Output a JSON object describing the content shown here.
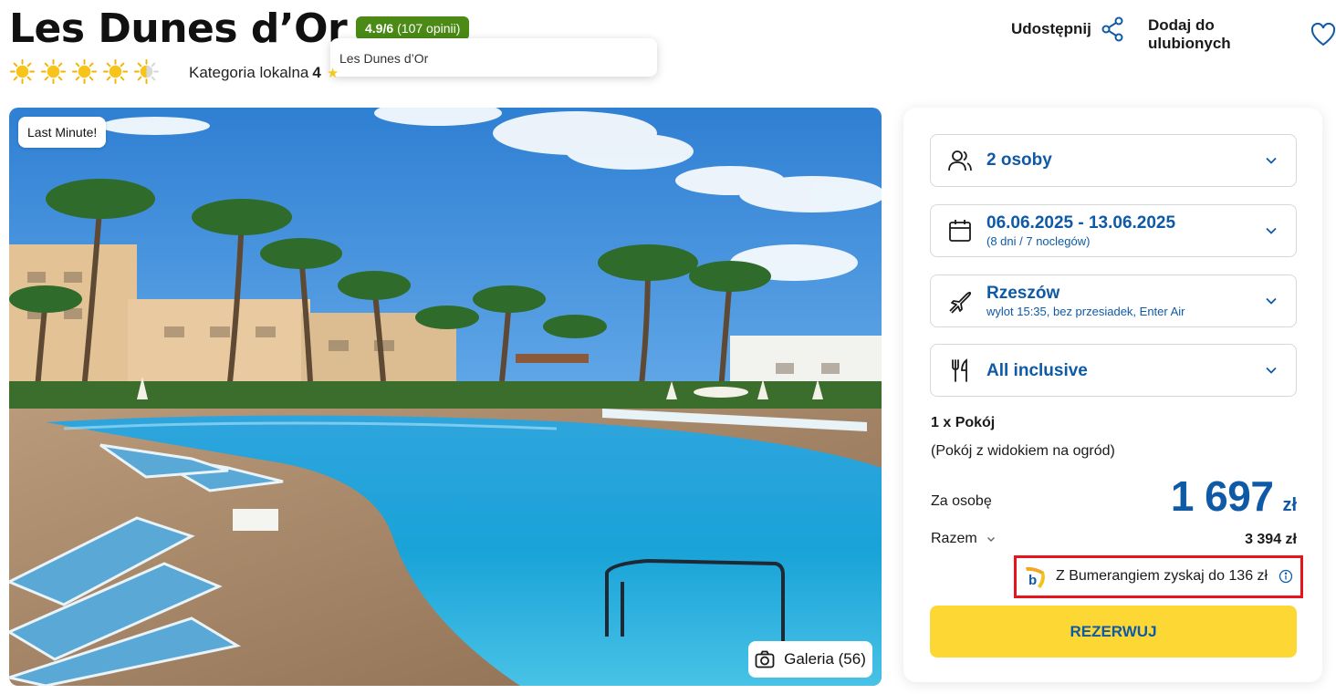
{
  "hotel": {
    "name": "Les Dunes d’Or",
    "rating": "4.9/6",
    "reviews": "(107 opinii)",
    "tooltip": "Les Dunes d’Or",
    "category_label": "Kategoria lokalna",
    "category_value": "4",
    "sun_rating": 4.5
  },
  "actions": {
    "share_label": "Udostępnij",
    "favorite_label": "Dodaj do ulubionych"
  },
  "photo": {
    "badge": "Last Minute!",
    "gallery_label": "Galeria (56)"
  },
  "booking": {
    "persons": "2 osoby",
    "dates": "06.06.2025 - 13.06.2025",
    "dates_sub": "(8 dni / 7 noclegów)",
    "departure": "Rzeszów",
    "departure_sub": "wylot 15:35, bez przesiadek, Enter Air",
    "board": "All inclusive",
    "room_title": "1 x Pokój",
    "room_sub": "(Pokój z widokiem na ogród)",
    "per_person_label": "Za osobę",
    "price": "1 697",
    "currency": "zł",
    "total_label": "Razem",
    "total_value": "3 394 zł",
    "bumerang_text": "Z Bumerangiem zyskaj do 136 zł",
    "reserve_label": "REZERWUJ"
  },
  "colors": {
    "accent_blue": "#0f5aa6",
    "rating_green": "#4a8a15",
    "reserve_yellow": "#fdd835",
    "highlight_red": "#e8141b"
  },
  "icons": [
    "sun-icon",
    "star-icon",
    "share-icon",
    "heart-icon",
    "camera-icon",
    "people-icon",
    "calendar-icon",
    "plane-icon",
    "cutlery-icon",
    "chevron-down-icon",
    "bumerang-logo",
    "info-icon"
  ]
}
